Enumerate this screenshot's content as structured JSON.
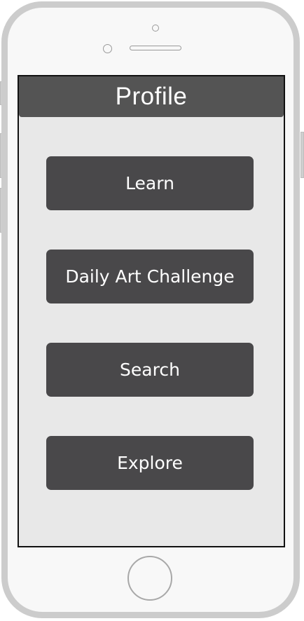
{
  "header": {
    "title": "Profile"
  },
  "menu": {
    "items": [
      {
        "label": "Learn"
      },
      {
        "label": "Daily Art Challenge"
      },
      {
        "label": "Search"
      },
      {
        "label": "Explore"
      }
    ]
  },
  "colors": {
    "header_bg": "#545454",
    "button_bg": "#49484a",
    "screen_bg": "#e8e8e8",
    "phone_frame": "#cccccc"
  },
  "icons": {
    "home": "home-button-icon",
    "camera": "camera-icon",
    "speaker": "speaker-icon",
    "sensor": "sensor-icon"
  }
}
